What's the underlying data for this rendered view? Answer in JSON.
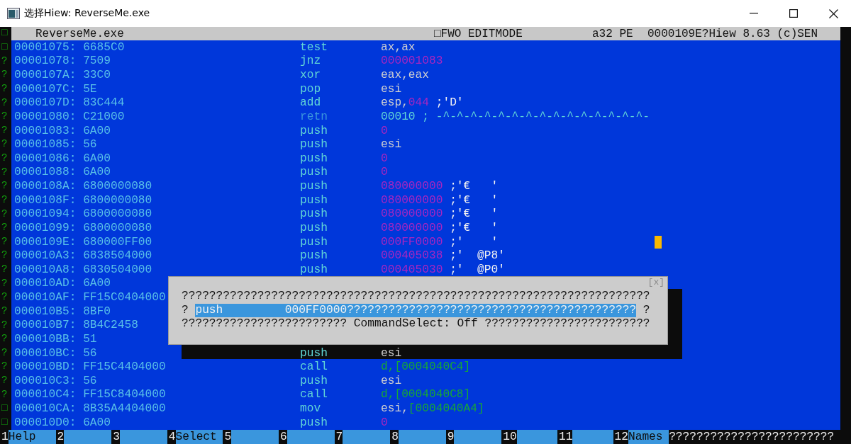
{
  "window": {
    "title": "选择Hiew: ReverseMe.exe"
  },
  "header": {
    "marker": "□",
    "file": "ReverseMe.exe",
    "mode": "□FWO EDITMODE",
    "arch": "a32 PE",
    "info": "0000109E?Hiew 8.63 (c)SEN"
  },
  "rows": [
    {
      "marker": "□",
      "address": "00001075: 6685C0",
      "mnemonic": "test",
      "kind": "code",
      "operand": [
        {
          "text": "ax,ax",
          "kind": "reg"
        }
      ]
    },
    {
      "marker": "?",
      "address": "00001078: 7509",
      "mnemonic": "jnz",
      "kind": "code",
      "operand": [
        {
          "text": "000001083",
          "kind": "num"
        }
      ]
    },
    {
      "marker": "?",
      "address": "0000107A: 33C0",
      "mnemonic": "xor",
      "kind": "code",
      "operand": [
        {
          "text": "eax,eax",
          "kind": "reg"
        }
      ]
    },
    {
      "marker": "?",
      "address": "0000107C: 5E",
      "mnemonic": "pop",
      "kind": "code",
      "operand": [
        {
          "text": "esi",
          "kind": "reg"
        }
      ]
    },
    {
      "marker": "?",
      "address": "0000107D: 83C444",
      "mnemonic": "add",
      "kind": "code",
      "operand": [
        {
          "text": "esp,",
          "kind": "reg"
        },
        {
          "text": "044",
          "kind": "num"
        },
        {
          "text": " ;'D'",
          "kind": "comment"
        }
      ]
    },
    {
      "marker": "?",
      "address": "00001080: C21000",
      "mnemonic": "retn",
      "kind": "return",
      "operand": [
        {
          "text": "00010 ; -^-^-^-^-^-^-^-^-^-^-^-^-^-^-^-",
          "kind": "line"
        }
      ]
    },
    {
      "marker": "?",
      "address": "00001083: 6A00",
      "mnemonic": "push",
      "kind": "code",
      "operand": [
        {
          "text": "0",
          "kind": "num"
        }
      ]
    },
    {
      "marker": "?",
      "address": "00001085: 56",
      "mnemonic": "push",
      "kind": "code",
      "operand": [
        {
          "text": "esi",
          "kind": "reg"
        }
      ]
    },
    {
      "marker": "?",
      "address": "00001086: 6A00",
      "mnemonic": "push",
      "kind": "code",
      "operand": [
        {
          "text": "0",
          "kind": "num"
        }
      ]
    },
    {
      "marker": "?",
      "address": "00001088: 6A00",
      "mnemonic": "push",
      "kind": "code",
      "operand": [
        {
          "text": "0",
          "kind": "num"
        }
      ]
    },
    {
      "marker": "?",
      "address": "0000108A: 6800000080",
      "mnemonic": "push",
      "kind": "code",
      "operand": [
        {
          "text": "080000000",
          "kind": "num"
        },
        {
          "text": " ;'€   '",
          "kind": "comment"
        }
      ]
    },
    {
      "marker": "?",
      "address": "0000108F: 6800000080",
      "mnemonic": "push",
      "kind": "code",
      "operand": [
        {
          "text": "080000000",
          "kind": "num"
        },
        {
          "text": " ;'€   '",
          "kind": "comment"
        }
      ]
    },
    {
      "marker": "?",
      "address": "00001094: 6800000080",
      "mnemonic": "push",
      "kind": "code",
      "operand": [
        {
          "text": "080000000",
          "kind": "num"
        },
        {
          "text": " ;'€   '",
          "kind": "comment"
        }
      ]
    },
    {
      "marker": "?",
      "address": "00001099: 6800000080",
      "mnemonic": "push",
      "kind": "code",
      "operand": [
        {
          "text": "080000000",
          "kind": "num"
        },
        {
          "text": " ;'€   '",
          "kind": "comment"
        }
      ]
    },
    {
      "marker": "?",
      "address": "0000109E: 680000FF00",
      "mnemonic": "push",
      "kind": "code",
      "operand": [
        {
          "text": "000FF0000",
          "kind": "num"
        },
        {
          "text": " ;'    '",
          "kind": "comment"
        }
      ]
    },
    {
      "marker": "?",
      "address": "000010A3: 6838504000",
      "mnemonic": "push",
      "kind": "code",
      "operand": [
        {
          "text": "000405038",
          "kind": "num"
        },
        {
          "text": " ;'  @P8'",
          "kind": "comment"
        }
      ]
    },
    {
      "marker": "?",
      "address": "000010A8: 6830504000",
      "mnemonic": "push",
      "kind": "code",
      "operand": [
        {
          "text": "000405030",
          "kind": "num"
        },
        {
          "text": " ;'  @P0'",
          "kind": "comment"
        }
      ]
    },
    {
      "marker": "?",
      "address": "000010AD: 6A00",
      "operand": []
    },
    {
      "marker": "?",
      "address": "000010AF: FF15C0404000",
      "operand": []
    },
    {
      "marker": "?",
      "address": "000010B5: 8BF0",
      "operand": []
    },
    {
      "marker": "?",
      "address": "000010B7: 8B4C2458",
      "operand": []
    },
    {
      "marker": "?",
      "address": "000010BB: 51",
      "operand": []
    },
    {
      "marker": "?",
      "address": "000010BC: 56",
      "mnemonic": "push",
      "kind": "code",
      "operand": [
        {
          "text": "esi",
          "kind": "reg"
        }
      ]
    },
    {
      "marker": "?",
      "address": "000010BD: FF15C4404000",
      "mnemonic": "call",
      "kind": "code",
      "operand": [
        {
          "text": "d,[0004040C4]",
          "kind": "mem"
        }
      ]
    },
    {
      "marker": "?",
      "address": "000010C3: 56",
      "mnemonic": "push",
      "kind": "code",
      "operand": [
        {
          "text": "esi",
          "kind": "reg"
        }
      ]
    },
    {
      "marker": "?",
      "address": "000010C4: FF15C8404000",
      "mnemonic": "call",
      "kind": "code",
      "operand": [
        {
          "text": "d,[0004040C8]",
          "kind": "mem"
        }
      ]
    },
    {
      "marker": "□",
      "address": "000010CA: 8B35A4404000",
      "mnemonic": "mov",
      "kind": "code",
      "operand": [
        {
          "text": "esi,",
          "kind": "reg"
        },
        {
          "text": "[0004040A4]",
          "kind": "mem"
        }
      ]
    },
    {
      "marker": "□",
      "address": "000010D0: 6A00",
      "mnemonic": "push",
      "kind": "code",
      "operand": [
        {
          "text": "0",
          "kind": "num"
        }
      ]
    }
  ],
  "dialog": {
    "close": "[x]",
    "line_1": "????????????????????????????????????????????????????????????????????",
    "line_2_start": "? ",
    "selection": "push         000FF0000??????????????????????????????????????????",
    "line_2_end": " ?",
    "line_3": "???????????????????????? CommandSelect: Off ????????????????????????"
  },
  "function_keys": [
    {
      "number": "1",
      "label": "Help"
    },
    {
      "number": "2"
    },
    {
      "number": "3"
    },
    {
      "number": "4",
      "label": "Select"
    },
    {
      "number": "5"
    },
    {
      "number": "6"
    },
    {
      "number": "7"
    },
    {
      "number": "8"
    },
    {
      "number": "9"
    },
    {
      "number": "10"
    },
    {
      "number": "11"
    },
    {
      "number": "12",
      "label": "Names"
    }
  ],
  "function_tail": "????????????????????????"
}
